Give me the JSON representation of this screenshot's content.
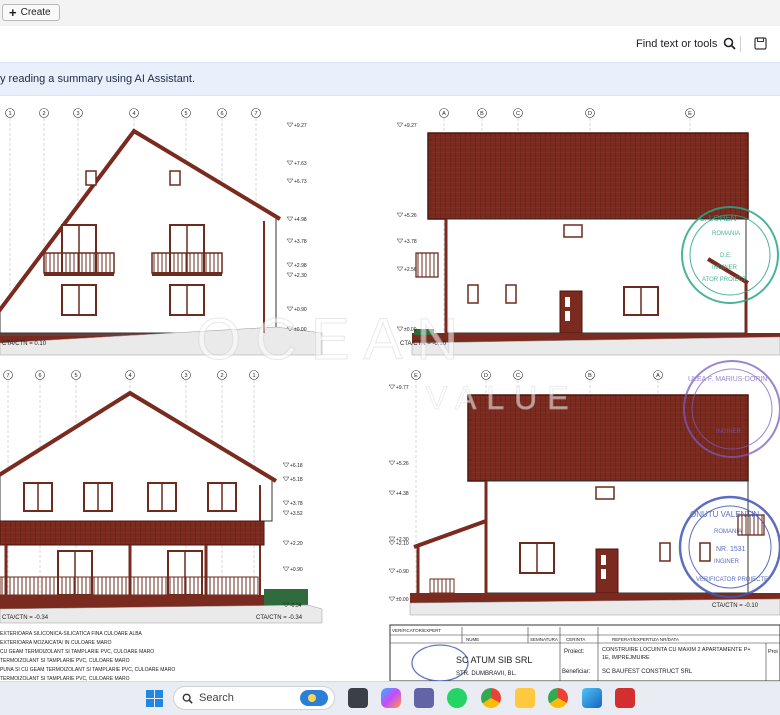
{
  "app": {
    "create_label": "Create",
    "find_label": "Find text or tools",
    "banner_text": "y reading a summary using AI Assistant."
  },
  "taskbar": {
    "search_placeholder": "Search",
    "apps": [
      "calculator-icon",
      "copilot-icon",
      "teams-icon",
      "whatsapp-icon",
      "chrome-icon",
      "file-explorer-icon",
      "chrome-icon",
      "photos-icon",
      "acrobat-icon"
    ]
  },
  "drawing": {
    "watermark_line1": "OCEAN",
    "watermark_line2": "VALUE",
    "tl_levels": [
      "+9.27",
      "+7.63",
      "+6.73",
      "+4.98",
      "+3.78",
      "+2.98",
      "+2.30",
      "+0.90",
      "±0.00"
    ],
    "tl_label": "CTA/CTN = 0.10",
    "tr_levels": [
      "+9.27",
      "+5.26",
      "+3.78",
      "+2.56",
      "±0.00"
    ],
    "tr_label": "CTA/CTN = -0.10",
    "bl_levels": [
      "+6.18",
      "+5.18",
      "+3.78",
      "+3.52",
      "+2.20",
      "+0.90",
      "-0.34"
    ],
    "bl_label": "CTA/CTN = -0.34",
    "br_levels": [
      "+9.77",
      "+5.26",
      "+4.38",
      "+2.30",
      "+2.10",
      "+0.90",
      "±0.00"
    ],
    "br_label": "CTA/CTN = -0.10",
    "axes_tl": [
      "1",
      "2",
      "3",
      "4",
      "5",
      "6",
      "7"
    ],
    "axes_tr": [
      "A",
      "B",
      "C",
      "D",
      "E"
    ],
    "axes_bl": [
      "7",
      "6",
      "5",
      "4",
      "3",
      "2",
      "1"
    ],
    "axes_br": [
      "E",
      "D",
      "C",
      "B",
      "A"
    ],
    "stamp1": [
      "L. LOHEN",
      "ROMANIA",
      "D.E.",
      "INGINER",
      "ATOR PROIECT"
    ],
    "stamp2": [
      "ULEA F. MARIUS-DORIN",
      "INGINER"
    ],
    "stamp3": [
      "ONUTU VALENTIN",
      "ROMANIA",
      "NR. 1531",
      "INGINER",
      "VERIFICATOR PROIECTE"
    ],
    "notes": [
      "EXTERIOARA SILICONICA-SILICATICA FINA CULOARE ALBA",
      "EXTERIOARA MOZAICATA/ IN CULOARE MARO",
      "CU GEAM TERMOIZOLANT SI TAMPLARIE PVC, CULOARE MARO",
      "TERMOIZOLANT SI TAMPLARIE PVC, CULOARE MARO",
      "PUNA SI CU GEAM TERMOIZOLANT SI TAMPLARIE PVC, CULOARE MARO",
      "TERMOIZOLANT SI TAMPLARIE PVC, CULOARE MARO"
    ],
    "title_block": {
      "header_left": "VERIFICATOR/EXPERT",
      "header_nume": "NUME",
      "header_semnatura": "SEMNATURA",
      "header_cerinta": "CERINTA",
      "header_referat": "REFERAT/EXPERTIZA NR/DATA",
      "company": "SC ATUM SIB SRL",
      "company_sub": "STR. DUMBRAVII, BL.",
      "proiect_label": "Proiect:",
      "proiect_value": "CONSTRUIRE LOCUINTA CU MAXIM 2 APARTAMENTE P+",
      "proiect_value2": "1E, IMPREJMUIRE",
      "beneficiar_label": "Beneficiar:",
      "beneficiar_value": "SC BAUFEST CONSTRUCT SRL",
      "pr_label": "Proi"
    }
  }
}
